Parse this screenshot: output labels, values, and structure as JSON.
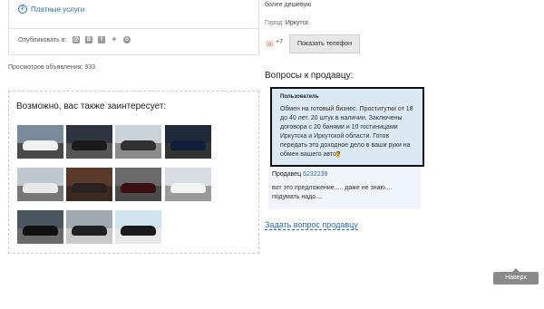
{
  "left": {
    "paid_services": "Платные услуги",
    "share_label": "Опубликовать в:",
    "share_icons": [
      "mail-icon",
      "vk-icon",
      "facebook-icon",
      "twitter-icon",
      "odnoklassniki-icon"
    ],
    "views": "Просмотров объявления: 933",
    "maybe_title": "Возможно, вас также заинтересует:",
    "thumbs": [
      {
        "name": "car-thumb-1",
        "sky": "#7a8a9a",
        "car": "#f2f2f2",
        "ground": "#4a4a4a"
      },
      {
        "name": "car-thumb-2",
        "sky": "#2e3440",
        "car": "#1a1a1a",
        "ground": "#555"
      },
      {
        "name": "car-thumb-3",
        "sky": "#c9d1d9",
        "car": "#303030",
        "ground": "#8c8c8c"
      },
      {
        "name": "car-thumb-4",
        "sky": "#1e2a3a",
        "car": "#0f1f3a",
        "ground": "#333"
      },
      {
        "name": "car-thumb-5",
        "sky": "#bfc8d0",
        "car": "#e9e9e9",
        "ground": "#777"
      },
      {
        "name": "car-thumb-6",
        "sky": "#5a3a2a",
        "car": "#2a2020",
        "ground": "#3a2a20"
      },
      {
        "name": "car-thumb-7",
        "sky": "#6a6a6a",
        "car": "#3a0f10",
        "ground": "#4a4a4a"
      },
      {
        "name": "car-thumb-8",
        "sky": "#d8dde3",
        "car": "#f4f4f4",
        "ground": "#9a9a9a"
      },
      {
        "name": "car-thumb-9",
        "sky": "#4a5560",
        "car": "#101010",
        "ground": "#6a6a6a"
      },
      {
        "name": "car-thumb-10",
        "sky": "#a0a8b0",
        "car": "#202020",
        "ground": "#c8c8c8"
      },
      {
        "name": "car-thumb-11",
        "sky": "#d0e4ee",
        "car": "#1a1a1a",
        "ground": "#e8e8e8"
      }
    ]
  },
  "right": {
    "cheaper_text": "более дешевую",
    "city_label": "Город:",
    "city_value": "Иркутск",
    "phone_prefix": "+7",
    "show_phone": "Показать телефон",
    "questions_title": "Вопросы к продавцу:",
    "question_user": "Пользователь",
    "question_text": "Обмен на готовый бизнес. Проститутки от 18 до 40 лет. 20 штук в наличии. Заключены договора с 20 банями и 10 гостиницами Иркутска и Иркутской области. Готов передать это доходное дело в ваши руки на обмен вашего авто",
    "question_mark": "?",
    "answer_seller": "Продавец",
    "answer_id": "6232239",
    "answer_text": "вот это предложение..... даже не знаю.... подумать надо....",
    "ask_link": "Задать вопрос продавцу",
    "back_label": "Наверх"
  }
}
